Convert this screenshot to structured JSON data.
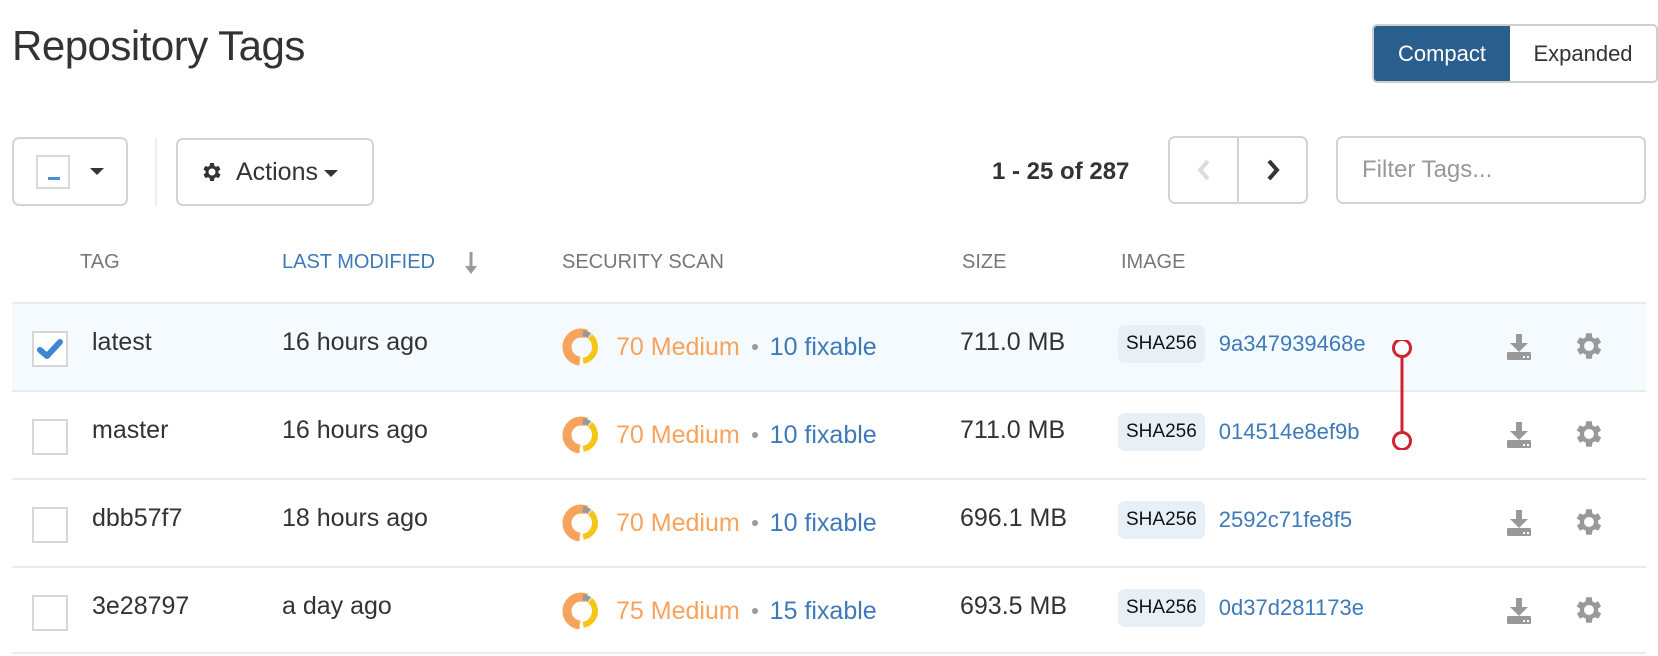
{
  "page": {
    "title": "Repository Tags"
  },
  "view_toggle": {
    "compact_label": "Compact",
    "expanded_label": "Expanded",
    "active": "Compact"
  },
  "toolbar": {
    "select_state": "partial",
    "actions_label": "Actions",
    "pager_text": "1 - 25 of 287",
    "prev_enabled": false,
    "next_enabled": true,
    "filter_placeholder": "Filter Tags...",
    "filter_value": ""
  },
  "table": {
    "columns": [
      {
        "label": "TAG",
        "sorted": false
      },
      {
        "label": "LAST MODIFIED",
        "sorted": true,
        "sort_direction": "descending"
      },
      {
        "label": "SECURITY SCAN",
        "sorted": false
      },
      {
        "label": "SIZE",
        "sorted": false
      },
      {
        "label": "IMAGE",
        "sorted": false
      }
    ],
    "rows": [
      {
        "tag": "latest",
        "modified": "16 hours ago",
        "severity": "70 Medium",
        "fixable": "10 fixable",
        "size": "711.0 MB",
        "digest_type": "SHA256",
        "digest": "9a347939468e",
        "checked": true
      },
      {
        "tag": "master",
        "modified": "16 hours ago",
        "severity": "70 Medium",
        "fixable": "10 fixable",
        "size": "711.0 MB",
        "digest_type": "SHA256",
        "digest": "014514e8ef9b",
        "checked": false
      },
      {
        "tag": "dbb57f7",
        "modified": "18 hours ago",
        "severity": "70 Medium",
        "fixable": "10 fixable",
        "size": "696.1 MB",
        "digest_type": "SHA256",
        "digest": "2592c71fe8f5",
        "checked": false
      },
      {
        "tag": "3e28797",
        "modified": "a day ago",
        "severity": "75 Medium",
        "fixable": "15 fixable",
        "size": "693.5 MB",
        "digest_type": "SHA256",
        "digest": "0d37d281173e",
        "checked": false
      }
    ]
  },
  "icons": {
    "row_download": "download-icon",
    "row_settings": "gear-icon",
    "same_image_link": "linked-images-indicator"
  },
  "colors": {
    "primary": "#2a5e8c",
    "link": "#3e7ab9",
    "medium_severity": "#f7a35c",
    "low_severity": "#f5c518",
    "unknown_severity": "#999999",
    "link_indicator": "#d0232f",
    "selected_row": "#f5faff"
  }
}
